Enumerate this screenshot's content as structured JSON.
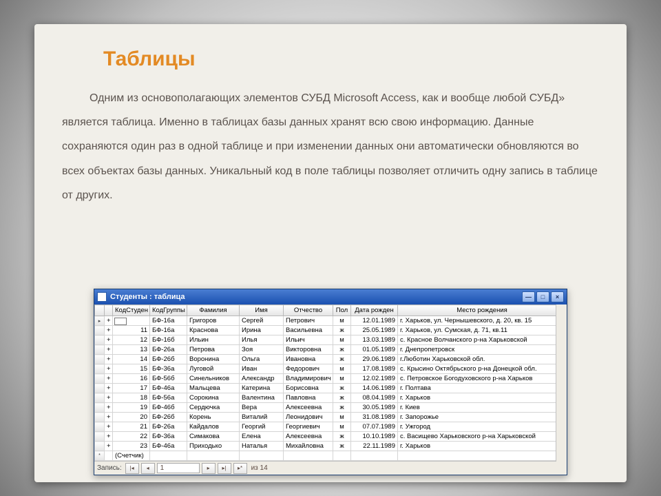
{
  "heading": "Таблицы",
  "paragraph": "Одним из основополагающих элементов СУБД Microsoft Access, как и вообще любой СУБД» является таблица. Именно в таблицах базы данных хранят всю свою информацию. Данные сохраняются один раз в одной таблице и при изменении данных они автоматически обновляются во всех объектах базы данных. Уникальный код в поле таблицы позволяет отличить одну запись в таблице от других.",
  "window": {
    "title": "Студенты : таблица",
    "columns": [
      "КодСтуден",
      "КодГруппы",
      "Фамилия",
      "Имя",
      "Отчество",
      "Пол",
      "Дата рожден",
      "Место рождения"
    ],
    "rows": [
      {
        "sel": "▸",
        "id": "",
        "grp": "БФ-16а",
        "fam": "Григоров",
        "name": "Сергей",
        "otch": "Петрович",
        "sex": "м",
        "date": "12.01.1989",
        "place": "г. Харьков, ул. Чернышевского, д. 20, кв. 15"
      },
      {
        "sel": "",
        "id": "11",
        "grp": "БФ-16а",
        "fam": "Краснова",
        "name": "Ирина",
        "otch": "Васильевна",
        "sex": "ж",
        "date": "25.05.1989",
        "place": "г. Харьков, ул. Сумская, д. 71, кв.11"
      },
      {
        "sel": "",
        "id": "12",
        "grp": "БФ-16б",
        "fam": "Ильин",
        "name": "Илья",
        "otch": "Ильич",
        "sex": "м",
        "date": "13.03.1989",
        "place": "с. Красное  Волчанского р-на  Харьковской"
      },
      {
        "sel": "",
        "id": "13",
        "grp": "БФ-26а",
        "fam": "Петрова",
        "name": "Зоя",
        "otch": "Викторовна",
        "sex": "ж",
        "date": "01.05.1989",
        "place": "г. Днепропетровск"
      },
      {
        "sel": "",
        "id": "14",
        "grp": "БФ-26б",
        "fam": "Воронина",
        "name": "Ольга",
        "otch": "Ивановна",
        "sex": "ж",
        "date": "29.06.1989",
        "place": "г.Люботин Харьковской обл."
      },
      {
        "sel": "",
        "id": "15",
        "grp": "БФ-36а",
        "fam": "Луговой",
        "name": "Иван",
        "otch": "Федорович",
        "sex": "м",
        "date": "17.08.1989",
        "place": "с. Крысино Октябрьского р-на Донецкой обл."
      },
      {
        "sel": "",
        "id": "16",
        "grp": "БФ-56б",
        "fam": "Синельников",
        "name": "Александр",
        "otch": "Владимирович",
        "sex": "м",
        "date": "12.02.1989",
        "place": "с. Петровское Богодуховского р-на Харьков"
      },
      {
        "sel": "",
        "id": "17",
        "grp": "БФ-46а",
        "fam": "Мальцева",
        "name": "Катерина",
        "otch": "Борисовна",
        "sex": "ж",
        "date": "14.06.1989",
        "place": "г. Полтава"
      },
      {
        "sel": "",
        "id": "18",
        "grp": "БФ-56а",
        "fam": "Сорокина",
        "name": "Валентина",
        "otch": "Павловна",
        "sex": "ж",
        "date": "08.04.1989",
        "place": "г. Харьков"
      },
      {
        "sel": "",
        "id": "19",
        "grp": "БФ-46б",
        "fam": "Сердючка",
        "name": "Вера",
        "otch": "Алексеевна",
        "sex": "ж",
        "date": "30.05.1989",
        "place": "г. Киев"
      },
      {
        "sel": "",
        "id": "20",
        "grp": "БФ-26б",
        "fam": "Корень",
        "name": "Виталий",
        "otch": "Леонидович",
        "sex": "м",
        "date": "31.08.1989",
        "place": "г. Запорожье"
      },
      {
        "sel": "",
        "id": "21",
        "grp": "БФ-26а",
        "fam": "Кайдалов",
        "name": "Георгий",
        "otch": "Георгиевич",
        "sex": "м",
        "date": "07.07.1989",
        "place": "г. Ужгород"
      },
      {
        "sel": "",
        "id": "22",
        "grp": "БФ-36а",
        "fam": "Симакова",
        "name": "Елена",
        "otch": "Алексеевна",
        "sex": "ж",
        "date": "10.10.1989",
        "place": "с. Васищево Харьковского р-на Харьковской"
      },
      {
        "sel": "",
        "id": "23",
        "grp": "БФ-46а",
        "fam": "Приходько",
        "name": "Наталья",
        "otch": "Михайловна",
        "sex": "ж",
        "date": "22.11.1989",
        "place": "г. Харьков"
      }
    ],
    "new_label": "(Счетчик)",
    "nav": {
      "label": "Запись:",
      "pos": "1",
      "total": "из  14"
    }
  }
}
